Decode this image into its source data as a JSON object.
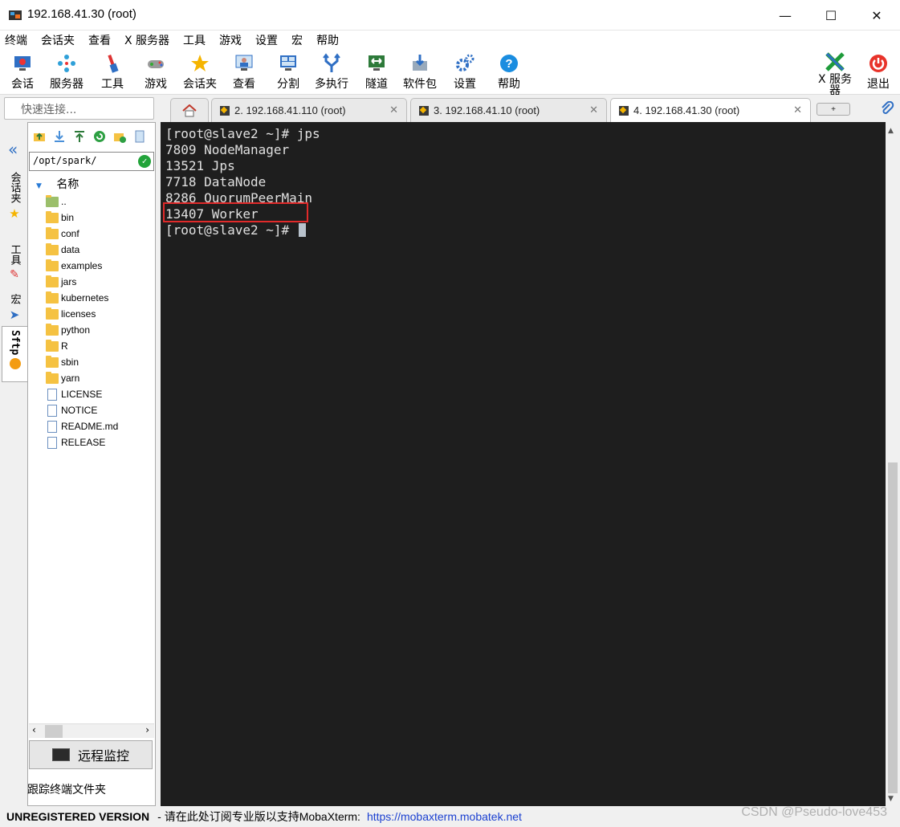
{
  "window": {
    "title": "192.168.41.30 (root)",
    "min_glyph": "—",
    "max_glyph": "☐",
    "close_glyph": "✕"
  },
  "menu": [
    "终端",
    "会话夹",
    "查看",
    "X 服务器",
    "工具",
    "游戏",
    "设置",
    "宏",
    "帮助"
  ],
  "toolbar": {
    "session": "会话",
    "servers": "服务器",
    "tools": "工具",
    "games": "游戏",
    "sessions_folder": "会话夹",
    "view": "查看",
    "split": "分割",
    "multiexec": "多执行",
    "tunnel": "隧道",
    "packages": "软件包",
    "settings": "设置",
    "help": "帮助",
    "xserver": "X 服务器",
    "exit": "退出"
  },
  "quick_connect": {
    "placeholder": "快速连接..."
  },
  "tabs": [
    {
      "label": "2. 192.168.41.110 (root)",
      "active": false
    },
    {
      "label": "3. 192.168.41.10 (root)",
      "active": false
    },
    {
      "label": "4. 192.168.41.30 (root)",
      "active": true
    }
  ],
  "side_tabs": {
    "sessions": "会话夹",
    "tools": "工具",
    "macros": "宏",
    "sftp": "Sftp"
  },
  "file_browser": {
    "path": "/opt/spark/",
    "column_header": "名称",
    "items": [
      {
        "name": "..",
        "type": "up"
      },
      {
        "name": "bin",
        "type": "folder"
      },
      {
        "name": "conf",
        "type": "folder"
      },
      {
        "name": "data",
        "type": "folder"
      },
      {
        "name": "examples",
        "type": "folder"
      },
      {
        "name": "jars",
        "type": "folder"
      },
      {
        "name": "kubernetes",
        "type": "folder"
      },
      {
        "name": "licenses",
        "type": "folder"
      },
      {
        "name": "python",
        "type": "folder"
      },
      {
        "name": "R",
        "type": "folder"
      },
      {
        "name": "sbin",
        "type": "folder"
      },
      {
        "name": "yarn",
        "type": "folder"
      },
      {
        "name": "LICENSE",
        "type": "file"
      },
      {
        "name": "NOTICE",
        "type": "file"
      },
      {
        "name": "README.md",
        "type": "file"
      },
      {
        "name": "RELEASE",
        "type": "file"
      }
    ],
    "remote_monitor": "远程监控",
    "follow_folder": "跟踪终端文件夹"
  },
  "terminal": {
    "lines": [
      "[root@slave2 ~]# jps",
      "7809 NodeManager",
      "13521 Jps",
      "7718 DataNode",
      "8286 QuorumPeerMain",
      "13407 Worker",
      "[root@slave2 ~]# "
    ]
  },
  "status": {
    "unregistered": "UNREGISTERED VERSION",
    "message": "-  请在此处订阅专业版以支持MobaXterm:",
    "link": "https://mobaxterm.mobatek.net"
  },
  "watermark": "CSDN @Pseudo-love453",
  "colors": {
    "terminal_bg": "#1e1e1e",
    "highlight": "#e02a2a",
    "link": "#1a3fd0"
  }
}
